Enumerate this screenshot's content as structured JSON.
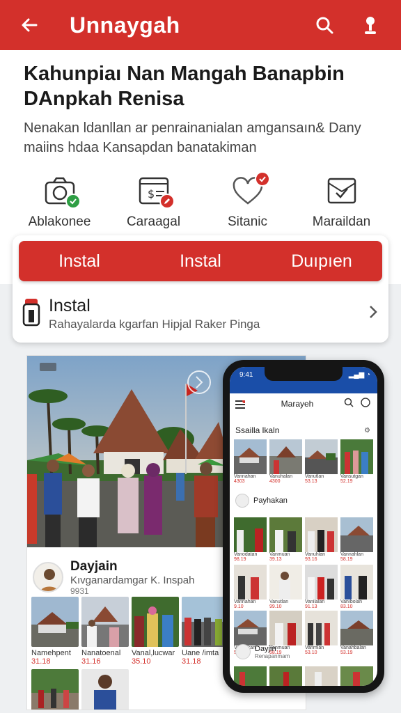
{
  "app_bar": {
    "title": "Unnaygah",
    "back_icon": "arrow-left-icon",
    "search_icon": "search-icon",
    "location_icon": "pin-icon"
  },
  "headline": "Kahunpiaı Nan Mangah Banapbin DAnpkah Renisa",
  "description": "Nenakan ldanllan ar penrainanialan amgansaın& Dany maiins hdaa Kansapdan banatakiman",
  "features": [
    {
      "label": "Ablakonee",
      "icon": "camera-icon",
      "badge": "check-badge",
      "badge_color": "#2e9e44"
    },
    {
      "label": "Caraagal",
      "icon": "dollar-screen-icon",
      "badge": "edit-badge",
      "badge_color": "#d3302b"
    },
    {
      "label": "Sitanic",
      "icon": "heart-icon",
      "badge": "check-badge",
      "badge_color": "#d3302b"
    },
    {
      "label": "Maraildan",
      "icon": "mail-check-icon",
      "badge": "",
      "badge_color": ""
    }
  ],
  "actions": {
    "buttons": [
      "Instal",
      "Instal",
      "Duıpıen"
    ]
  },
  "install_row": {
    "title": "Instal",
    "subtitle": "Rahayalarda kgarfan Hipjal Raker Pinga"
  },
  "feed": {
    "poster_name": "Dayjain",
    "poster_subtitle": "Kıvganardamgar K. Inspah",
    "poster_count": "9931",
    "thumbs": [
      {
        "caption": "Namehpent",
        "number": "31.18"
      },
      {
        "caption": "Nanatoenal",
        "number": "31.16"
      },
      {
        "caption": "Vanal,lucwar",
        "number": "35.10"
      },
      {
        "caption": "Uane /imta",
        "number": "31.18"
      }
    ]
  },
  "phone": {
    "app_title": "Marayeh",
    "section_title": "Ssailla lkaln",
    "user_name": "Payhakan",
    "footer_name": "Dayjin",
    "footer_sub": "Renapanmam",
    "row1": [
      {
        "caption": "Vannahan",
        "number": "4303"
      },
      {
        "caption": "Vanuhalan",
        "number": "4300"
      },
      {
        "caption": "Vanutlan",
        "number": "53.13"
      },
      {
        "caption": "Vansutgan",
        "number": "52.19"
      }
    ],
    "row2": [
      {
        "caption": "Vanodatan",
        "number": "98.19"
      },
      {
        "caption": "Vanmuan",
        "number": "39.13"
      },
      {
        "caption": "Vanuhlan",
        "number": "93.16"
      },
      {
        "caption": "Vannahlan",
        "number": "58.19"
      }
    ],
    "row3": [
      {
        "caption": "Vannahan",
        "number": "9.10"
      },
      {
        "caption": "Vanutlan",
        "number": "99.10"
      },
      {
        "caption": "Vanilalan",
        "number": "91.13"
      },
      {
        "caption": "Vanıbolan",
        "number": "83.10"
      }
    ],
    "row4": [
      {
        "caption": "Vanahkan",
        "number": "58.10"
      },
      {
        "caption": "Vanmuan",
        "number": "58.19"
      },
      {
        "caption": "Vanmlan",
        "number": "53.10"
      },
      {
        "caption": "Vanahbalan",
        "number": "53.19"
      }
    ]
  },
  "colors": {
    "brand_red": "#d3302b",
    "phone_status_blue": "#1a4ea8"
  }
}
